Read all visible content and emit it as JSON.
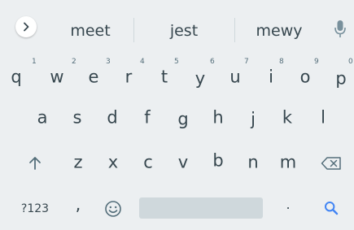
{
  "suggestions": [
    "meet",
    "jest",
    "mewy"
  ],
  "rows": {
    "row1": [
      {
        "key": "q",
        "hint": "1"
      },
      {
        "key": "w",
        "hint": "2"
      },
      {
        "key": "e",
        "hint": "3"
      },
      {
        "key": "r",
        "hint": "4"
      },
      {
        "key": "t",
        "hint": "5"
      },
      {
        "key": "y",
        "hint": "6"
      },
      {
        "key": "u",
        "hint": "7"
      },
      {
        "key": "i",
        "hint": "8"
      },
      {
        "key": "o",
        "hint": "9"
      },
      {
        "key": "p",
        "hint": "0"
      }
    ],
    "row2": [
      "a",
      "s",
      "d",
      "f",
      "g",
      "h",
      "j",
      "k",
      "l"
    ],
    "row3": [
      "z",
      "x",
      "c",
      "v",
      "b",
      "n",
      "m"
    ]
  },
  "bottom_row": {
    "symbols_label": "?123",
    "comma_label": ",",
    "period_label": "."
  },
  "icons": {
    "expand": "chevron-right-icon",
    "mic": "mic-icon",
    "shift": "shift-arrow-up-icon",
    "backspace": "backspace-icon",
    "emoji": "smiley-icon",
    "search": "search-icon"
  },
  "colors": {
    "background": "#eceff1",
    "key_text": "#37474f",
    "accent": "#4285f4",
    "space_bar": "#cfd8dc"
  }
}
